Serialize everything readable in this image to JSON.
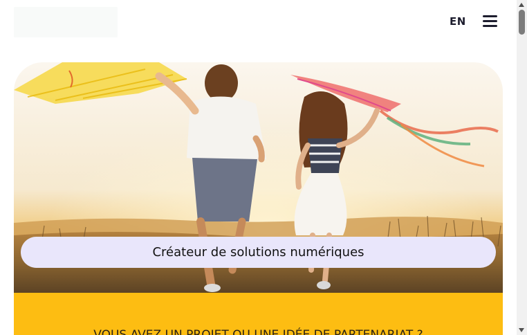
{
  "header": {
    "lang_label": "EN",
    "menu_icon": "hamburger-menu-icon"
  },
  "hero": {
    "image_subject": "children-running-with-kites",
    "tagline": "Créateur de solutions numériques"
  },
  "cta": {
    "text": "VOUS AVEZ UN PROJET OU UNE IDÉE DE PARTENARIAT ?",
    "background": "#fdbd12"
  },
  "colors": {
    "tagline_bg": "#e9e6fb",
    "text_dark": "#1d1d2e"
  }
}
